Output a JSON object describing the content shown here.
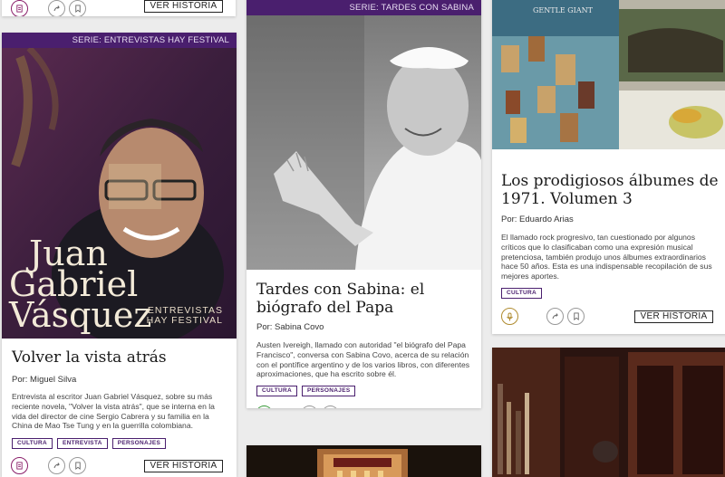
{
  "ver_historia": "VER HISTORIA",
  "cards": {
    "vasquez": {
      "series": "SERIE: ENTREVISTAS HAY FESTIVAL",
      "image_text": {
        "name_line1": "Juan",
        "name_line2": "Gabriel",
        "name_line3": "Vásquez",
        "sub1": "ENTREVISTAS",
        "sub2": "HAY FESTIVAL"
      },
      "title": "Volver la vista atrás",
      "byline": "Por: Miguel Silva",
      "summary": "Entrevista al escritor Juan Gabriel Vásquez, sobre su más reciente novela, \"Volver la vista atrás\", que se interna en la vida del director de cine Sergio Cabrera y su familia en la China de Mao Tse Tung y en la guerrilla colombiana.",
      "tags": [
        "CULTURA",
        "ENTREVISTA",
        "PERSONAJES"
      ]
    },
    "sabina": {
      "series": "SERIE: TARDES CON SABINA",
      "title": "Tardes con Sabina: el biógrafo del Papa",
      "byline": "Por: Sabina Covo",
      "summary": "Austen Ivereigh, llamado con autoridad \"el biógrafo del Papa Francisco\", conversa con Sabina Covo, acerca de su relación con el pontífice argentino y de los varios libros, con diferentes aproximaciones, que ha escrito sobre él.",
      "tags": [
        "CULTURA",
        "PERSONAJES"
      ]
    },
    "albums": {
      "title": "Los prodigiosos álbumes de 1971. Volumen 3",
      "byline": "Por: Eduardo Arias",
      "summary": "El llamado rock progresivo, tan cuestionado por algunos críticos que lo clasificaban como una expresión musical pretenciosa, también produjo unos álbumes extraordinarios hace 50 años. Esta es una indispensable recopilación de sus mejores aportes.",
      "tags": [
        "CULTURA"
      ],
      "album_text": "GENTLE GIANT"
    }
  },
  "colors": {
    "brand": "#4a1f6e",
    "accent": "#8a1f6a",
    "video": "#3a9a3a",
    "audio": "#b08c30"
  }
}
